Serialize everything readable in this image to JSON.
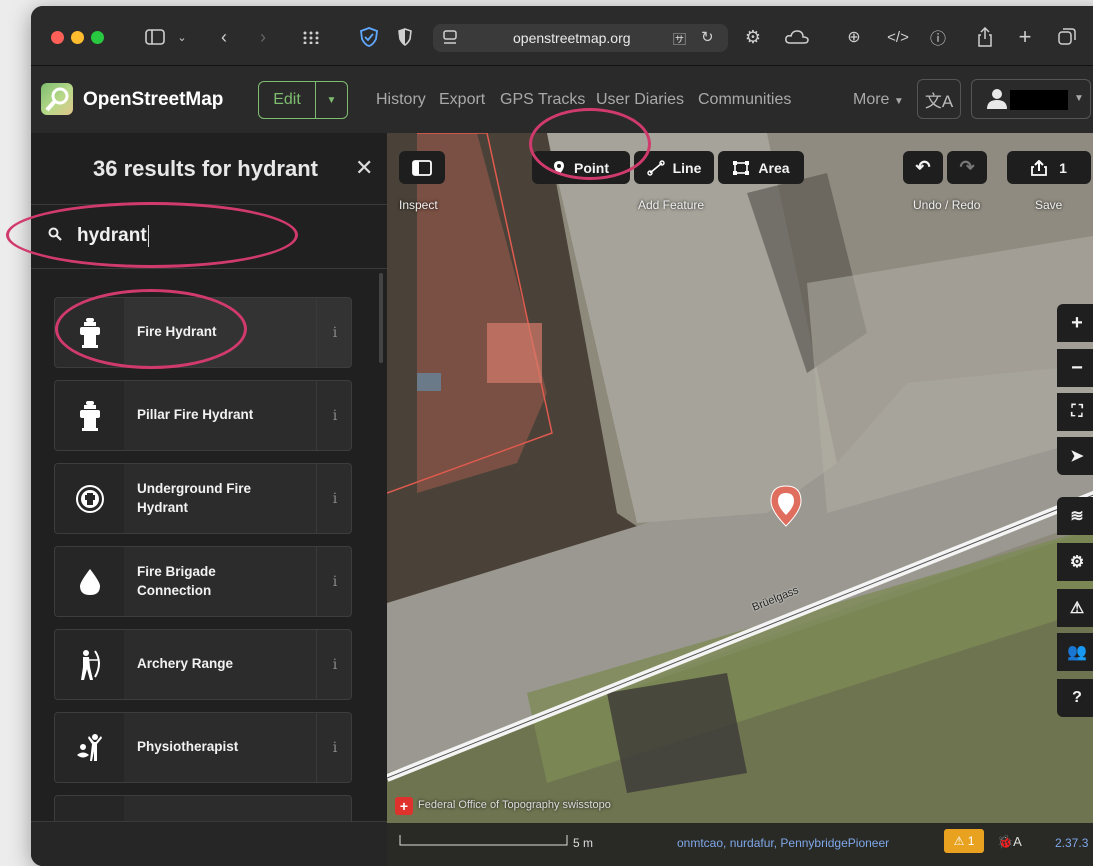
{
  "browser": {
    "url": "openstreetmap.org",
    "icons": [
      "sidebar-icon",
      "back-icon",
      "forward-icon",
      "grid-icon",
      "shield-icon",
      "privacy-icon",
      "page-icon",
      "translate-icon",
      "reload-icon",
      "settings-icon",
      "cloud-icon",
      "download-icon",
      "code-icon",
      "info-icon",
      "share-icon",
      "new-tab-icon",
      "tabs-icon"
    ]
  },
  "header": {
    "brand": "OpenStreetMap",
    "edit_label": "Edit",
    "nav": [
      "History",
      "Export",
      "GPS Tracks",
      "User Diaries",
      "Communities"
    ],
    "more_label": "More"
  },
  "sidebar": {
    "title": "36 results for hydrant",
    "search_value": "hydrant",
    "results": [
      {
        "label": "Fire Hydrant",
        "icon": "fire-hydrant-icon"
      },
      {
        "label": "Pillar Fire Hydrant",
        "icon": "pillar-hydrant-icon"
      },
      {
        "label": "Underground Fire Hydrant",
        "icon": "underground-hydrant-icon"
      },
      {
        "label": "Fire Brigade Connection",
        "icon": "water-drop-icon"
      },
      {
        "label": "Archery Range",
        "icon": "archer-icon"
      },
      {
        "label": "Physiotherapist",
        "icon": "physio-icon"
      }
    ],
    "info_glyph": "i"
  },
  "map": {
    "toolbar": {
      "inspect_label": "Inspect",
      "point_label": "Point",
      "line_label": "Line",
      "area_label": "Area",
      "add_feature_label": "Add Feature",
      "undo_redo_label": "Undo / Redo",
      "save_count": "1",
      "save_label": "Save"
    },
    "street_name": "Brüelgass",
    "controls": [
      "+",
      "−"
    ],
    "attribution": "Federal Office of Topography swisstopo",
    "scale_label": "5 m",
    "contributors": "onmtcao, nurdafur, PennybridgePioneer",
    "issues_count": "1",
    "version": "2.37.3",
    "colors": {
      "accent": "#7ebc6f",
      "annotation": "#d13a6c",
      "pin": "#e06e5f",
      "building": "#e05a4f"
    }
  }
}
